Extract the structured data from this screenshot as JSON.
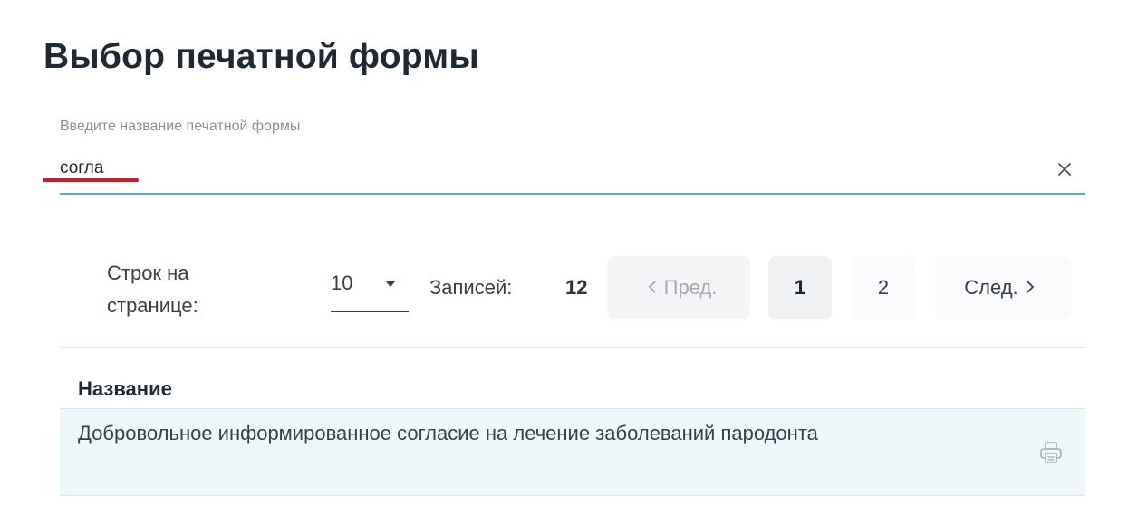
{
  "dialog": {
    "title": "Выбор печатной формы"
  },
  "search": {
    "label": "Введите название печатной формы",
    "value": "согла",
    "clear_icon": "close-icon",
    "accent_color": "#3cb4e5",
    "annotation_color": "#c41e2a"
  },
  "pager": {
    "rows_label": "Строк на странице:",
    "page_size": "10",
    "records_label": "Записей:",
    "records_count": "12",
    "prev_label": "Пред.",
    "next_label": "След.",
    "pages": [
      "1",
      "2"
    ],
    "current_page": "1",
    "prev_icon": "chevron-left-icon",
    "next_icon": "chevron-right-icon"
  },
  "table": {
    "column_header": "Название",
    "rows": [
      {
        "name": "Добровольное информированное согласие на лечение заболеваний пародонта",
        "action_icon": "printer-icon"
      }
    ],
    "row_highlight_color": "#eef8fb"
  }
}
